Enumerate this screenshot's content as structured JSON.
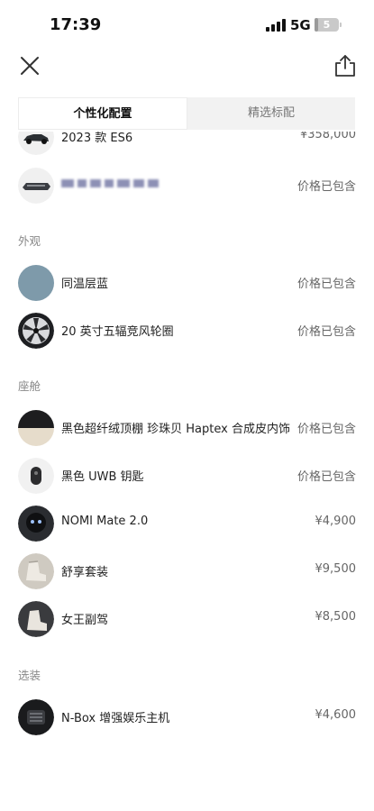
{
  "status_bar": {
    "time": "17:39",
    "network": "5G",
    "battery": "5",
    "battery_level": 0.05
  },
  "header": {
    "close_icon": "close-icon",
    "share_icon": "share-icon"
  },
  "tabs": [
    {
      "label": "个性化配置",
      "active": true
    },
    {
      "label": "精选标配",
      "active": false
    }
  ],
  "items_top": [
    {
      "name": "2023 款 ES6",
      "price": "¥358,000",
      "icon": "car-thumbnail"
    },
    {
      "name": "",
      "price": "价格已包含",
      "icon": "battery-pack-thumbnail"
    }
  ],
  "sections": [
    {
      "title": "外观",
      "items": [
        {
          "name": "同温层蓝",
          "price": "价格已包含",
          "icon": "paint-color-swatch",
          "color": "#7e9aaa"
        },
        {
          "name": "20 英寸五辐竞风轮圈",
          "price": "价格已包含",
          "icon": "wheel-rim-thumbnail"
        }
      ]
    },
    {
      "title": "座舱",
      "items": [
        {
          "name": "黑色超纤绒顶棚 珍珠贝 Haptex 合成皮内饰",
          "price": "价格已包含",
          "icon": "interior-trim-thumbnail"
        },
        {
          "name": "黑色 UWB 钥匙",
          "price": "价格已包含",
          "icon": "key-fob-thumbnail"
        },
        {
          "name": "NOMI Mate 2.0",
          "price": "¥4,900",
          "icon": "nomi-thumbnail"
        },
        {
          "name": "舒享套装",
          "price": "¥9,500",
          "icon": "seat-package-thumbnail"
        },
        {
          "name": "女王副驾",
          "price": "¥8,500",
          "icon": "queen-seat-thumbnail"
        }
      ]
    },
    {
      "title": "选装",
      "items": [
        {
          "name": "N-Box 增强娱乐主机",
          "price": "¥4,600",
          "icon": "nbox-thumbnail"
        }
      ]
    }
  ]
}
